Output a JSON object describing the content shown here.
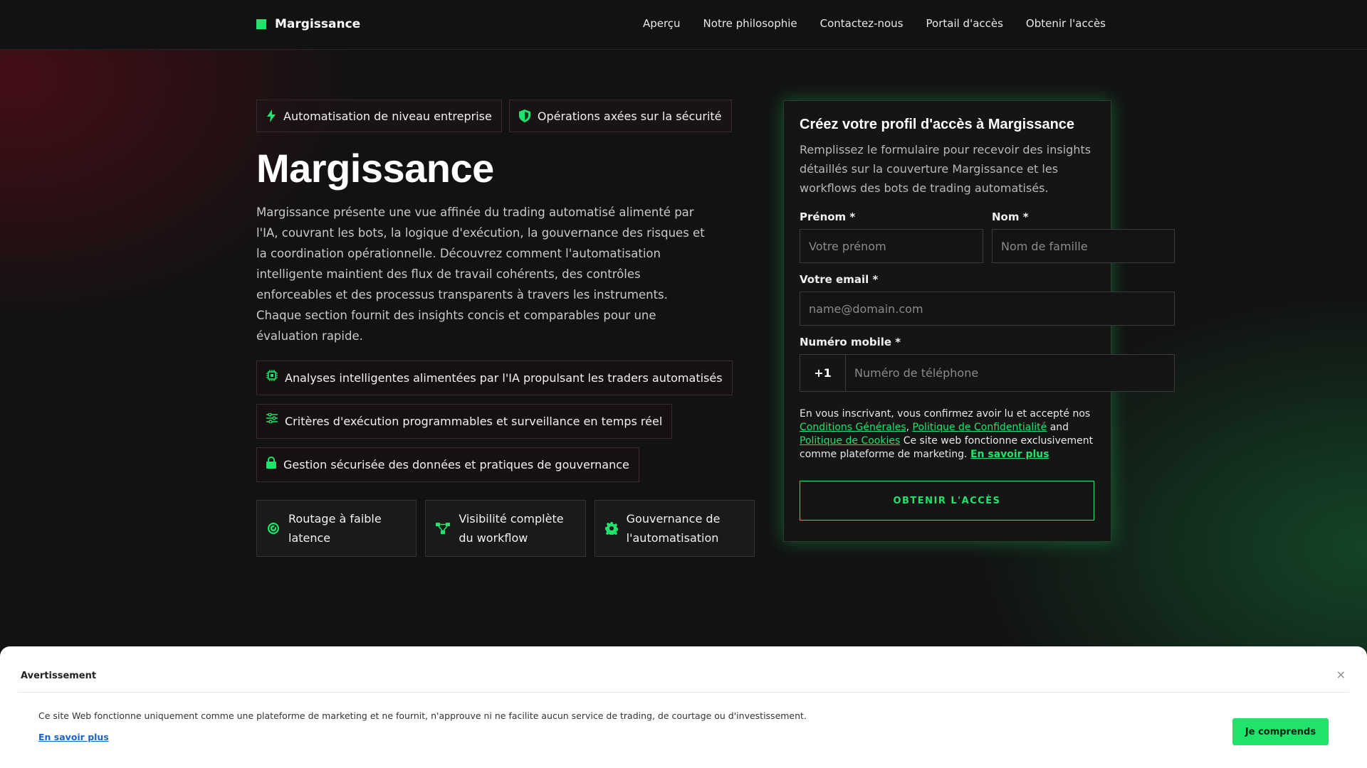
{
  "brand": {
    "name": "Margissance",
    "accent": "#1fe36a"
  },
  "nav": [
    {
      "label": "Aperçu"
    },
    {
      "label": "Notre philosophie"
    },
    {
      "label": "Contactez-nous"
    },
    {
      "label": "Portail d'accès"
    },
    {
      "label": "Obtenir l'accès"
    }
  ],
  "hero": {
    "badges": [
      {
        "icon": "lightning-icon",
        "label": "Automatisation de niveau entreprise"
      },
      {
        "icon": "shield-icon",
        "label": "Opérations axées sur la sécurité"
      }
    ],
    "title": "Margissance",
    "description": "Margissance présente une vue affinée du trading automatisé alimenté par l'IA, couvrant les bots, la logique d'exécution, la gouvernance des risques et la coordination opérationnelle. Découvrez comment l'automatisation intelligente maintient des flux de travail cohérents, des contrôles enforceables et des processus transparents à travers les instruments. Chaque section fournit des insights concis et comparables pour une évaluation rapide.",
    "features": [
      {
        "icon": "chip-icon",
        "label": "Analyses intelligentes alimentées par l'IA propulsant les traders automatisés"
      },
      {
        "icon": "sliders-icon",
        "label": "Critères d'exécution programmables et surveillance en temps réel"
      },
      {
        "icon": "lock-icon",
        "label": "Gestion sécurisée des données et pratiques de gouvernance"
      }
    ],
    "cards": [
      {
        "icon": "gauge-icon",
        "label": "Routage à faible latence"
      },
      {
        "icon": "workflow-icon",
        "label": "Visibilité complète du workflow"
      },
      {
        "icon": "gear-icon",
        "label": "Gouvernance de l'automatisation"
      }
    ]
  },
  "form": {
    "title": "Créez votre profil d'accès à Margissance",
    "description": "Remplissez le formulaire pour recevoir des insights détaillés sur la couverture Margissance et les workflows des bots de trading automatisés.",
    "first_name": {
      "label": "Prénom *",
      "placeholder": "Votre prénom"
    },
    "last_name": {
      "label": "Nom *",
      "placeholder": "Nom de famille"
    },
    "email": {
      "label": "Votre email *",
      "placeholder": "name@domain.com"
    },
    "phone": {
      "label": "Numéro mobile *",
      "code": "+1",
      "placeholder": "Numéro de téléphone"
    },
    "legal": {
      "prefix": "En vous inscrivant, vous confirmez avoir lu et accepté nos",
      "terms": "Conditions Générales",
      "sep": ",",
      "privacy": "Politique de Confidentialité",
      "and": "and",
      "cookies": "Politique de Cookies",
      "suffix": "Ce site web fonctionne exclusivement comme plateforme de marketing.",
      "learn_more": "En savoir plus"
    },
    "submit_label": "OBTENIR L'ACCÈS"
  },
  "disclaimer": {
    "title": "Avertissement",
    "close": "×",
    "text": "Ce site Web fonctionne uniquement comme une plateforme de marketing et ne fournit, n'approuve ni ne facilite aucun service de trading, de courtage ou d'investissement.",
    "link": "En savoir plus",
    "button": "Je comprends"
  }
}
